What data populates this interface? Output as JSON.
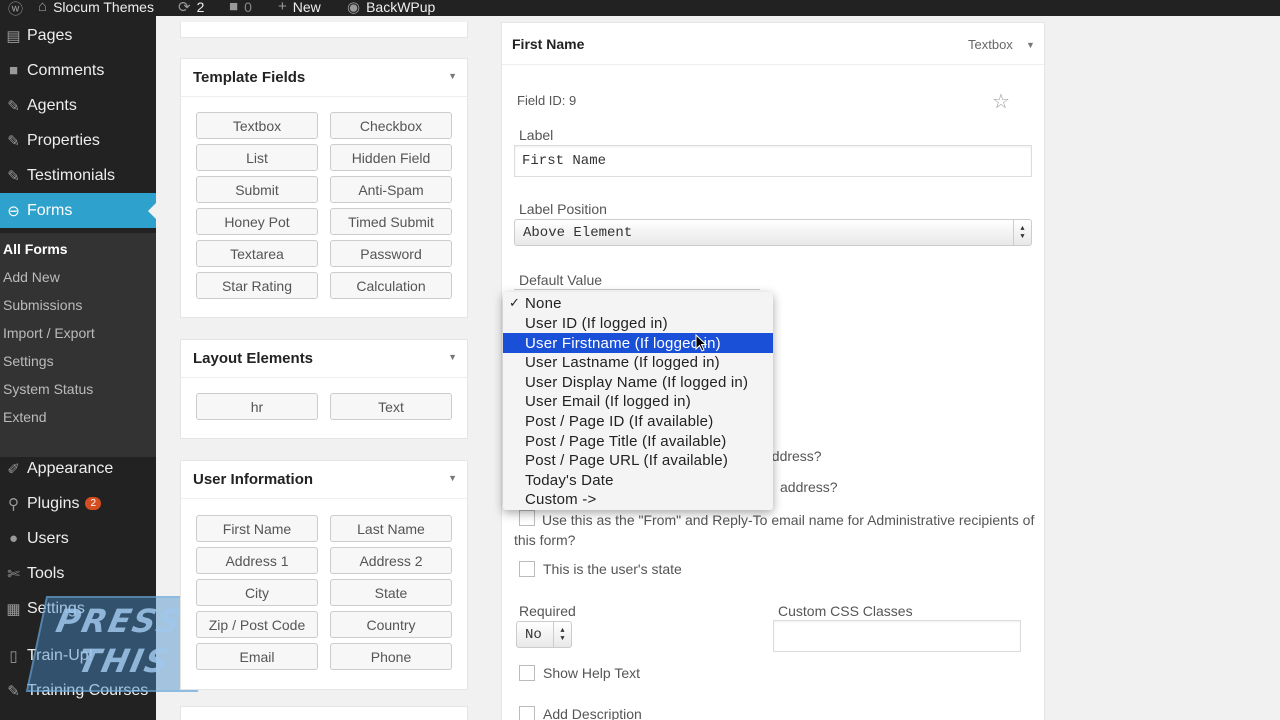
{
  "adminbar": {
    "site": "Slocum Themes",
    "updates": "2",
    "comments": "0",
    "new": "New",
    "plugin": "BackWPup"
  },
  "sidebar": {
    "items": [
      {
        "label": "Pages",
        "icon": "pages-icon"
      },
      {
        "label": "Comments",
        "icon": "comments-icon"
      },
      {
        "label": "Agents",
        "icon": "pin-icon"
      },
      {
        "label": "Properties",
        "icon": "pin-icon"
      },
      {
        "label": "Testimonials",
        "icon": "pin-icon"
      },
      {
        "label": "Forms",
        "icon": "forms-icon"
      }
    ],
    "submenu": [
      "All Forms",
      "Add New",
      "Submissions",
      "Import / Export",
      "Settings",
      "System Status",
      "Extend"
    ],
    "lower_items": [
      {
        "label": "Appearance",
        "icon": "brush-icon"
      },
      {
        "label": "Plugins",
        "icon": "plugin-icon",
        "badge": "2"
      },
      {
        "label": "Users",
        "icon": "users-icon"
      },
      {
        "label": "Tools",
        "icon": "tools-icon"
      },
      {
        "label": "Settings",
        "icon": "settings-icon"
      },
      {
        "label": "Train-Up!",
        "icon": "book-icon"
      },
      {
        "label": "Training Courses",
        "icon": "pin-icon"
      }
    ]
  },
  "watermark": {
    "line1": "PRESS",
    "line2": "THIS"
  },
  "template_fields": {
    "title": "Template Fields",
    "buttons": [
      "Textbox",
      "Checkbox",
      "List",
      "Hidden Field",
      "Submit",
      "Anti-Spam",
      "Honey Pot",
      "Timed Submit",
      "Textarea",
      "Password",
      "Star Rating",
      "Calculation"
    ]
  },
  "layout_elements": {
    "title": "Layout Elements",
    "buttons": [
      "hr",
      "Text"
    ]
  },
  "user_information": {
    "title": "User Information",
    "buttons": [
      "First Name",
      "Last Name",
      "Address 1",
      "Address 2",
      "City",
      "State",
      "Zip / Post Code",
      "Country",
      "Email",
      "Phone"
    ]
  },
  "field": {
    "title": "First Name",
    "type": "Textbox",
    "field_id": "Field ID: 9",
    "label_caption": "Label",
    "label_value": "First Name",
    "label_position_caption": "Label Position",
    "label_position_value": "Above Element",
    "default_value_caption": "Default Value",
    "hidden_text_1": "address?",
    "hidden_text_2": "address?",
    "from_name_text": "Use this as the \"From\" and Reply-To email name for Administrative recipients of this form?",
    "state_text": "This is the user's state",
    "required_caption": "Required",
    "required_value": "No",
    "css_caption": "Custom CSS Classes",
    "help_text": "Show Help Text",
    "description_text": "Add Description"
  },
  "dropdown": {
    "options": [
      "None",
      "User ID (If logged in)",
      "User Firstname (If logged in)",
      "User Lastname (If logged in)",
      "User Display Name (If logged in)",
      "User Email (If logged in)",
      "Post / Page ID (If available)",
      "Post / Page Title (If available)",
      "Post / Page URL (If available)",
      "Today's Date",
      "Custom ->"
    ],
    "selected_index": 0,
    "highlighted_index": 2
  }
}
